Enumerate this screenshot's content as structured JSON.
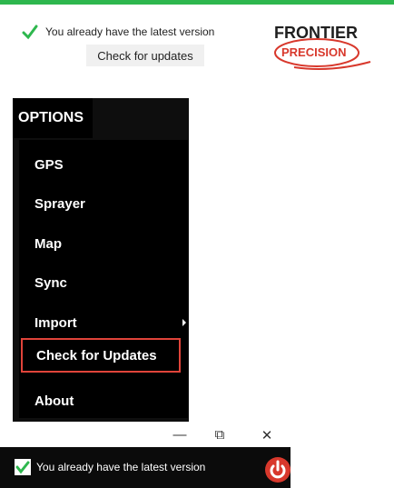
{
  "top": {
    "status_text": "You already have the latest version",
    "check_button_label": "Check for updates"
  },
  "logo": {
    "line1": "FRONTIER",
    "line2": "PRECISION"
  },
  "options": {
    "title": "OPTIONS",
    "items": [
      {
        "label": "GPS"
      },
      {
        "label": "Sprayer"
      },
      {
        "label": "Map"
      },
      {
        "label": "Sync"
      },
      {
        "label": "Import"
      },
      {
        "label": "Check for Updates"
      },
      {
        "label": "About"
      }
    ]
  },
  "window_controls": {
    "minimize": "—",
    "restore": "⧉",
    "close": "✕"
  },
  "bottom": {
    "status_text": "You already have the latest version"
  },
  "colors": {
    "accent_green": "#2eb74e",
    "highlight_red": "#e0443a",
    "power_red": "#d8382c"
  },
  "icons": {
    "check": "check-icon",
    "submenu": "chevron-right-icon",
    "power": "power-icon"
  }
}
